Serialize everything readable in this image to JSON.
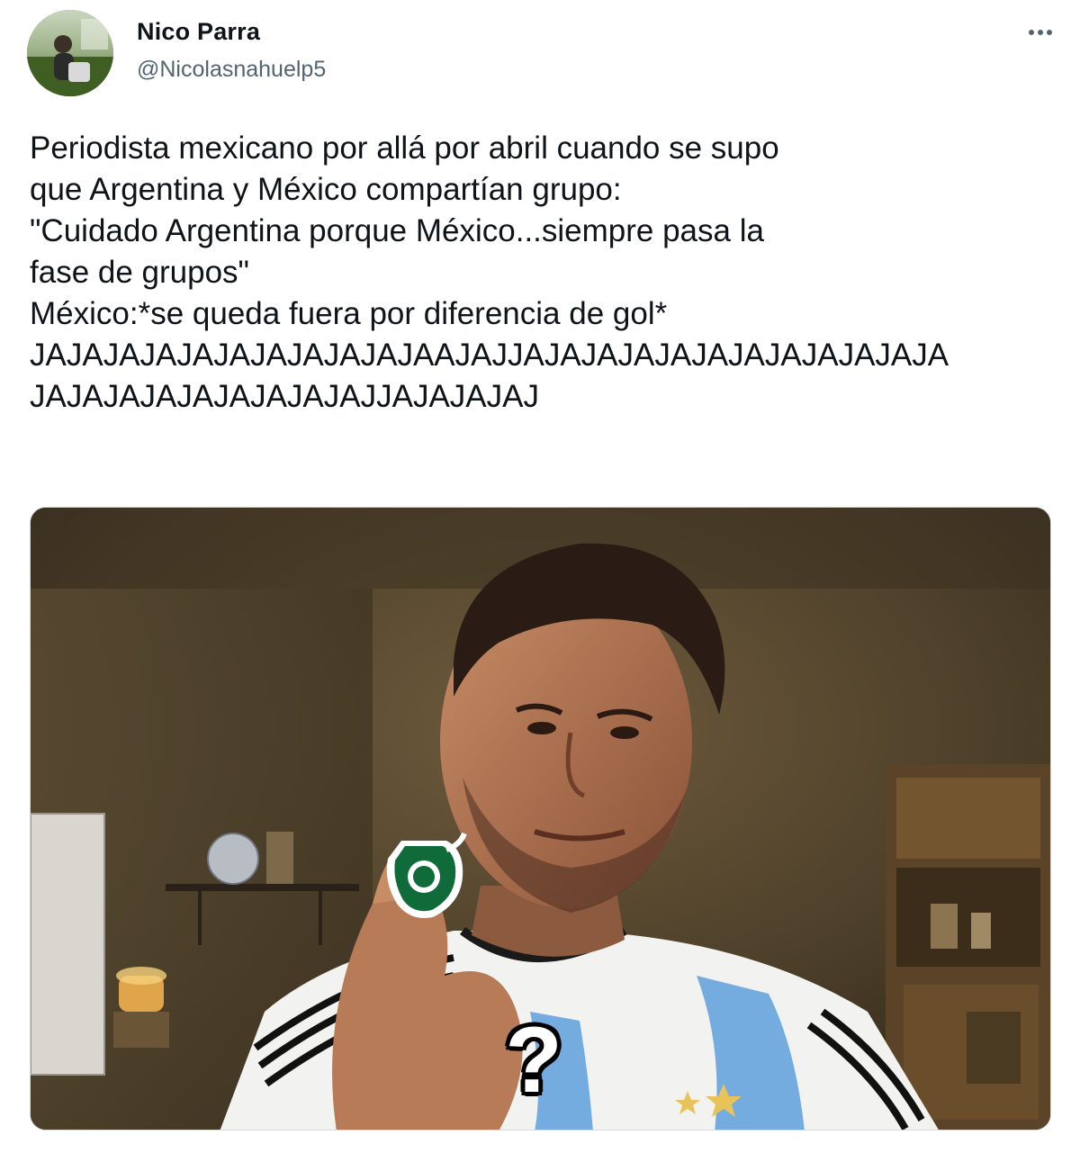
{
  "tweet": {
    "author": {
      "display_name": "Nico Parra",
      "handle": "@Nicolasnahuelp5"
    },
    "more_icon": "more-horizontal-icon",
    "text_lines": [
      "Periodista mexicano por allá por abril cuando se supo",
      "que Argentina y México compartían grupo:",
      "\"Cuidado Argentina porque México...siempre pasa la",
      "fase de grupos\"",
      "México:*se queda fuera por diferencia de gol*",
      "JAJAJAJAJAJAJAJAJAJAJAAJAJJAJAJAJAJAJAJAJAJAJAJAJA",
      "JAJAJAJAJAJAJAJAJAJJAJAJAJAJ"
    ],
    "media": {
      "overlay_text": "?"
    }
  },
  "colors": {
    "text_primary": "#0f1419",
    "text_secondary": "#536471",
    "border": "#cfd9de",
    "shirt_blue": "#74acdf",
    "badge_green": "#0f6b3a"
  }
}
